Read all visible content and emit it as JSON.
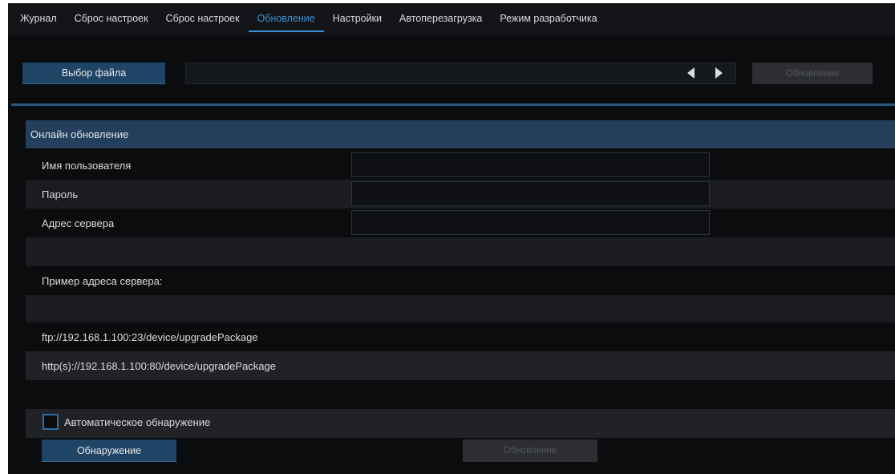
{
  "tabs": [
    {
      "label": "Журнал",
      "active": false
    },
    {
      "label": "Сброс настроек",
      "active": false
    },
    {
      "label": "Сброс настроек",
      "active": false
    },
    {
      "label": "Обновление",
      "active": true
    },
    {
      "label": "Настройки",
      "active": false
    },
    {
      "label": "Автоперезагрузка",
      "active": false
    },
    {
      "label": "Режим разработчика",
      "active": false
    }
  ],
  "file": {
    "select_label": "Выбор файла",
    "file_value": "",
    "update_label": "Обновление"
  },
  "online": {
    "title": "Онлайн обновление",
    "username_label": "Имя пользователя",
    "username_value": "",
    "password_label": "Пароль",
    "password_value": "",
    "server_label": "Адрес сервера",
    "server_value": "",
    "example_label": "Пример адреса сервера:",
    "example_ftp": "ftp://192.168.1.100:23/device/upgradePackage",
    "example_http": "http(s)://192.168.1.100:80/device/upgradePackage",
    "auto_detect_label": "Автоматическое обнаружение",
    "auto_detect_checked": false,
    "detect_button": "Обнаружение",
    "update_button": "Обновление"
  },
  "colors": {
    "accent": "#3d8fd6",
    "button": "#1f4466",
    "section_header": "#243f5c",
    "background": "#0b0c0e"
  }
}
